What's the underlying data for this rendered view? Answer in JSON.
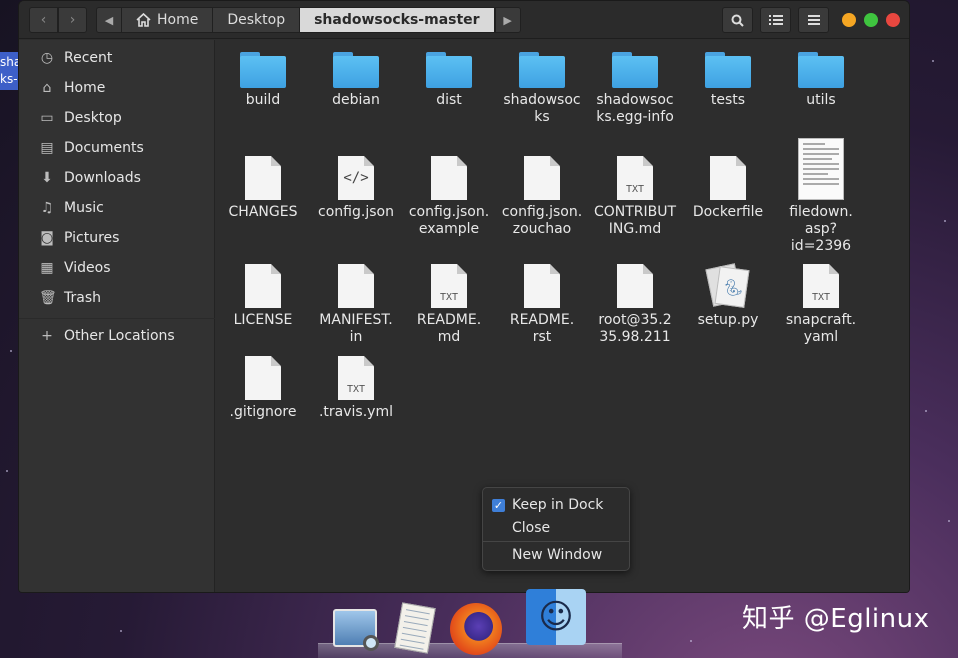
{
  "desktop": {
    "icon_label_lines": [
      "sha",
      "ks-"
    ]
  },
  "header": {
    "path": [
      "Home",
      "Desktop",
      "shadowsocks-master"
    ],
    "back_glyph": "‹",
    "forward_glyph": "›",
    "path_left_glyph": "◀",
    "path_right_glyph": "▶",
    "colors": {
      "minimize": "#f5a623",
      "maximize": "#3fc43f",
      "close": "#e8473f"
    }
  },
  "sidebar": {
    "items": [
      {
        "label": "Recent",
        "icon": "clock-icon"
      },
      {
        "label": "Home",
        "icon": "home-icon"
      },
      {
        "label": "Desktop",
        "icon": "desktop-icon"
      },
      {
        "label": "Documents",
        "icon": "documents-icon"
      },
      {
        "label": "Downloads",
        "icon": "downloads-icon"
      },
      {
        "label": "Music",
        "icon": "music-icon"
      },
      {
        "label": "Pictures",
        "icon": "pictures-icon"
      },
      {
        "label": "Videos",
        "icon": "videos-icon"
      },
      {
        "label": "Trash",
        "icon": "trash-icon"
      }
    ],
    "other_locations": {
      "label": "Other Locations",
      "icon": "plus-icon"
    }
  },
  "files": [
    {
      "name": "build",
      "kind": "folder"
    },
    {
      "name": "debian",
      "kind": "folder"
    },
    {
      "name": "dist",
      "kind": "folder"
    },
    {
      "name": "shadowsoc\nks",
      "kind": "folder"
    },
    {
      "name": "shadowsoc\nks.egg-info",
      "kind": "folder"
    },
    {
      "name": "tests",
      "kind": "folder"
    },
    {
      "name": "utils",
      "kind": "folder"
    },
    {
      "name": "CHANGES",
      "kind": "doc"
    },
    {
      "name": "config.json",
      "kind": "code",
      "badge": "</>"
    },
    {
      "name": "config.json.\nexample",
      "kind": "doc"
    },
    {
      "name": "config.json.\nzouchao",
      "kind": "doc"
    },
    {
      "name": "CONTRIBUT\nING.md",
      "kind": "txt",
      "badge": "TXT"
    },
    {
      "name": "Dockerfile",
      "kind": "doc"
    },
    {
      "name": "filedown.\nasp?\nid=2396",
      "kind": "thumb"
    },
    {
      "name": "LICENSE",
      "kind": "doc"
    },
    {
      "name": "MANIFEST.\nin",
      "kind": "doc"
    },
    {
      "name": "README.\nmd",
      "kind": "txt",
      "badge": "TXT"
    },
    {
      "name": "README.\nrst",
      "kind": "doc"
    },
    {
      "name": "root@35.2\n35.98.211",
      "kind": "doc"
    },
    {
      "name": "setup.py",
      "kind": "python"
    },
    {
      "name": "snapcraft.\nyaml",
      "kind": "txt",
      "badge": "TXT"
    },
    {
      "name": ".gitignore",
      "kind": "doc"
    },
    {
      "name": ".travis.yml",
      "kind": "txt",
      "badge": "TXT"
    }
  ],
  "context_menu": {
    "keep_in_dock": "Keep in Dock",
    "keep_checked": true,
    "close": "Close",
    "new_window": "New Window"
  },
  "dock": {
    "apps": [
      "image-viewer-icon",
      "text-editor-icon",
      "firefox-icon",
      "finder-icon"
    ]
  },
  "watermark": "知乎 @Eglinux"
}
